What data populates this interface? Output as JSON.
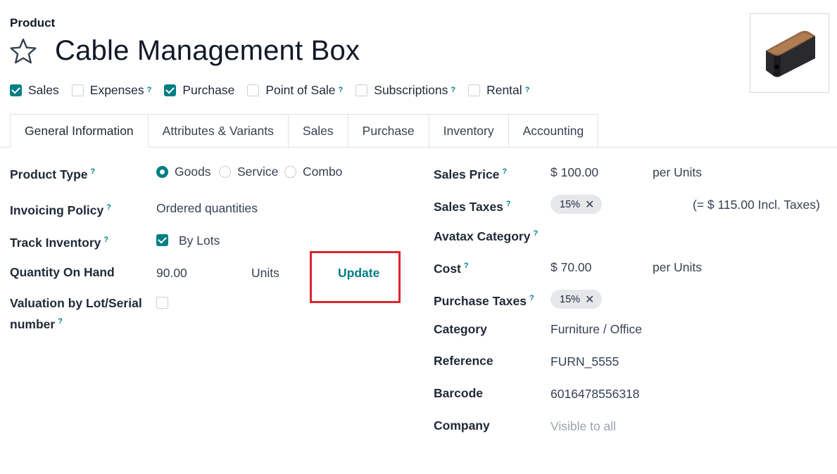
{
  "header": {
    "breadcrumb": "Product",
    "title": "Cable Management Box"
  },
  "flags": [
    {
      "label": "Sales",
      "checked": true,
      "help": false
    },
    {
      "label": "Expenses",
      "checked": false,
      "help": true
    },
    {
      "label": "Purchase",
      "checked": true,
      "help": false
    },
    {
      "label": "Point of Sale",
      "checked": false,
      "help": true
    },
    {
      "label": "Subscriptions",
      "checked": false,
      "help": true
    },
    {
      "label": "Rental",
      "checked": false,
      "help": true
    }
  ],
  "help_mark": "?",
  "tabs": [
    {
      "label": "General Information",
      "active": true
    },
    {
      "label": "Attributes & Variants",
      "active": false
    },
    {
      "label": "Sales",
      "active": false
    },
    {
      "label": "Purchase",
      "active": false
    },
    {
      "label": "Inventory",
      "active": false
    },
    {
      "label": "Accounting",
      "active": false
    }
  ],
  "left": {
    "product_type_label": "Product Type",
    "product_type_options": [
      "Goods",
      "Service",
      "Combo"
    ],
    "product_type_selected": "Goods",
    "invoicing_policy_label": "Invoicing Policy",
    "invoicing_policy_value": "Ordered quantities",
    "track_inventory_label": "Track Inventory",
    "track_inventory_value": "By Lots",
    "qty_on_hand_label": "Quantity On Hand",
    "qty_on_hand_value": "90.00",
    "qty_on_hand_uom": "Units",
    "update_label": "Update",
    "valuation_label_line1": "Valuation by Lot/Serial",
    "valuation_label_line2": "number"
  },
  "right": {
    "sales_price_label": "Sales Price",
    "sales_price_value": "$ 100.00",
    "sales_price_uom": "per Units",
    "sales_taxes_label": "Sales Taxes",
    "sales_taxes_tag": "15%",
    "sales_taxes_incl": "(= $ 115.00 Incl. Taxes)",
    "avatax_label": "Avatax Category",
    "cost_label": "Cost",
    "cost_value": "$ 70.00",
    "cost_uom": "per Units",
    "purchase_taxes_label": "Purchase Taxes",
    "purchase_taxes_tag": "15%",
    "category_label": "Category",
    "category_value": "Furniture / Office",
    "reference_label": "Reference",
    "reference_value": "FURN_5555",
    "barcode_label": "Barcode",
    "barcode_value": "6016478556318",
    "company_label": "Company",
    "company_placeholder": "Visible to all"
  },
  "icons": {
    "favorite": "star-outline-icon",
    "remove_tag": "close-icon",
    "tag_close_glyph": "✕"
  },
  "colors": {
    "accent": "#017e84",
    "highlight": "#d9262e"
  }
}
